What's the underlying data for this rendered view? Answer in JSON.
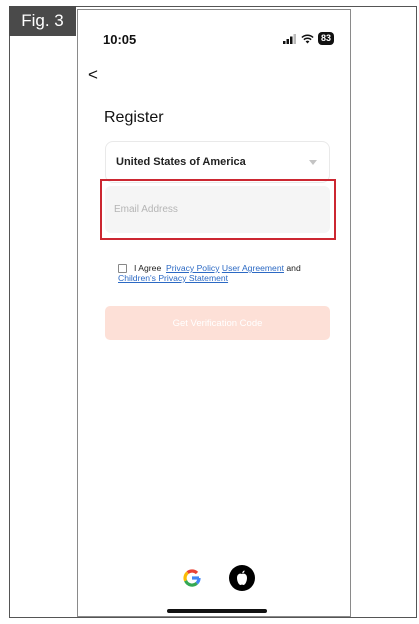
{
  "figure": {
    "label": "Fig. 3"
  },
  "status_bar": {
    "time": "10:05",
    "battery": "83"
  },
  "register": {
    "back": "<",
    "title": "Register",
    "country": "United States of America",
    "email_placeholder": "Email Address",
    "agree": {
      "prefix": "I Agree",
      "privacy_policy": "Privacy Policy",
      "user_agreement": "User Agreement",
      "and": "and",
      "childrens_privacy": "Children's Privacy Statement"
    },
    "verify_button": "Get Verification Code"
  },
  "social": {
    "google_letter": "G"
  },
  "colors": {
    "highlight": "#cc2731",
    "button_disabled": "#fde0d7",
    "link": "#2b69c4"
  }
}
